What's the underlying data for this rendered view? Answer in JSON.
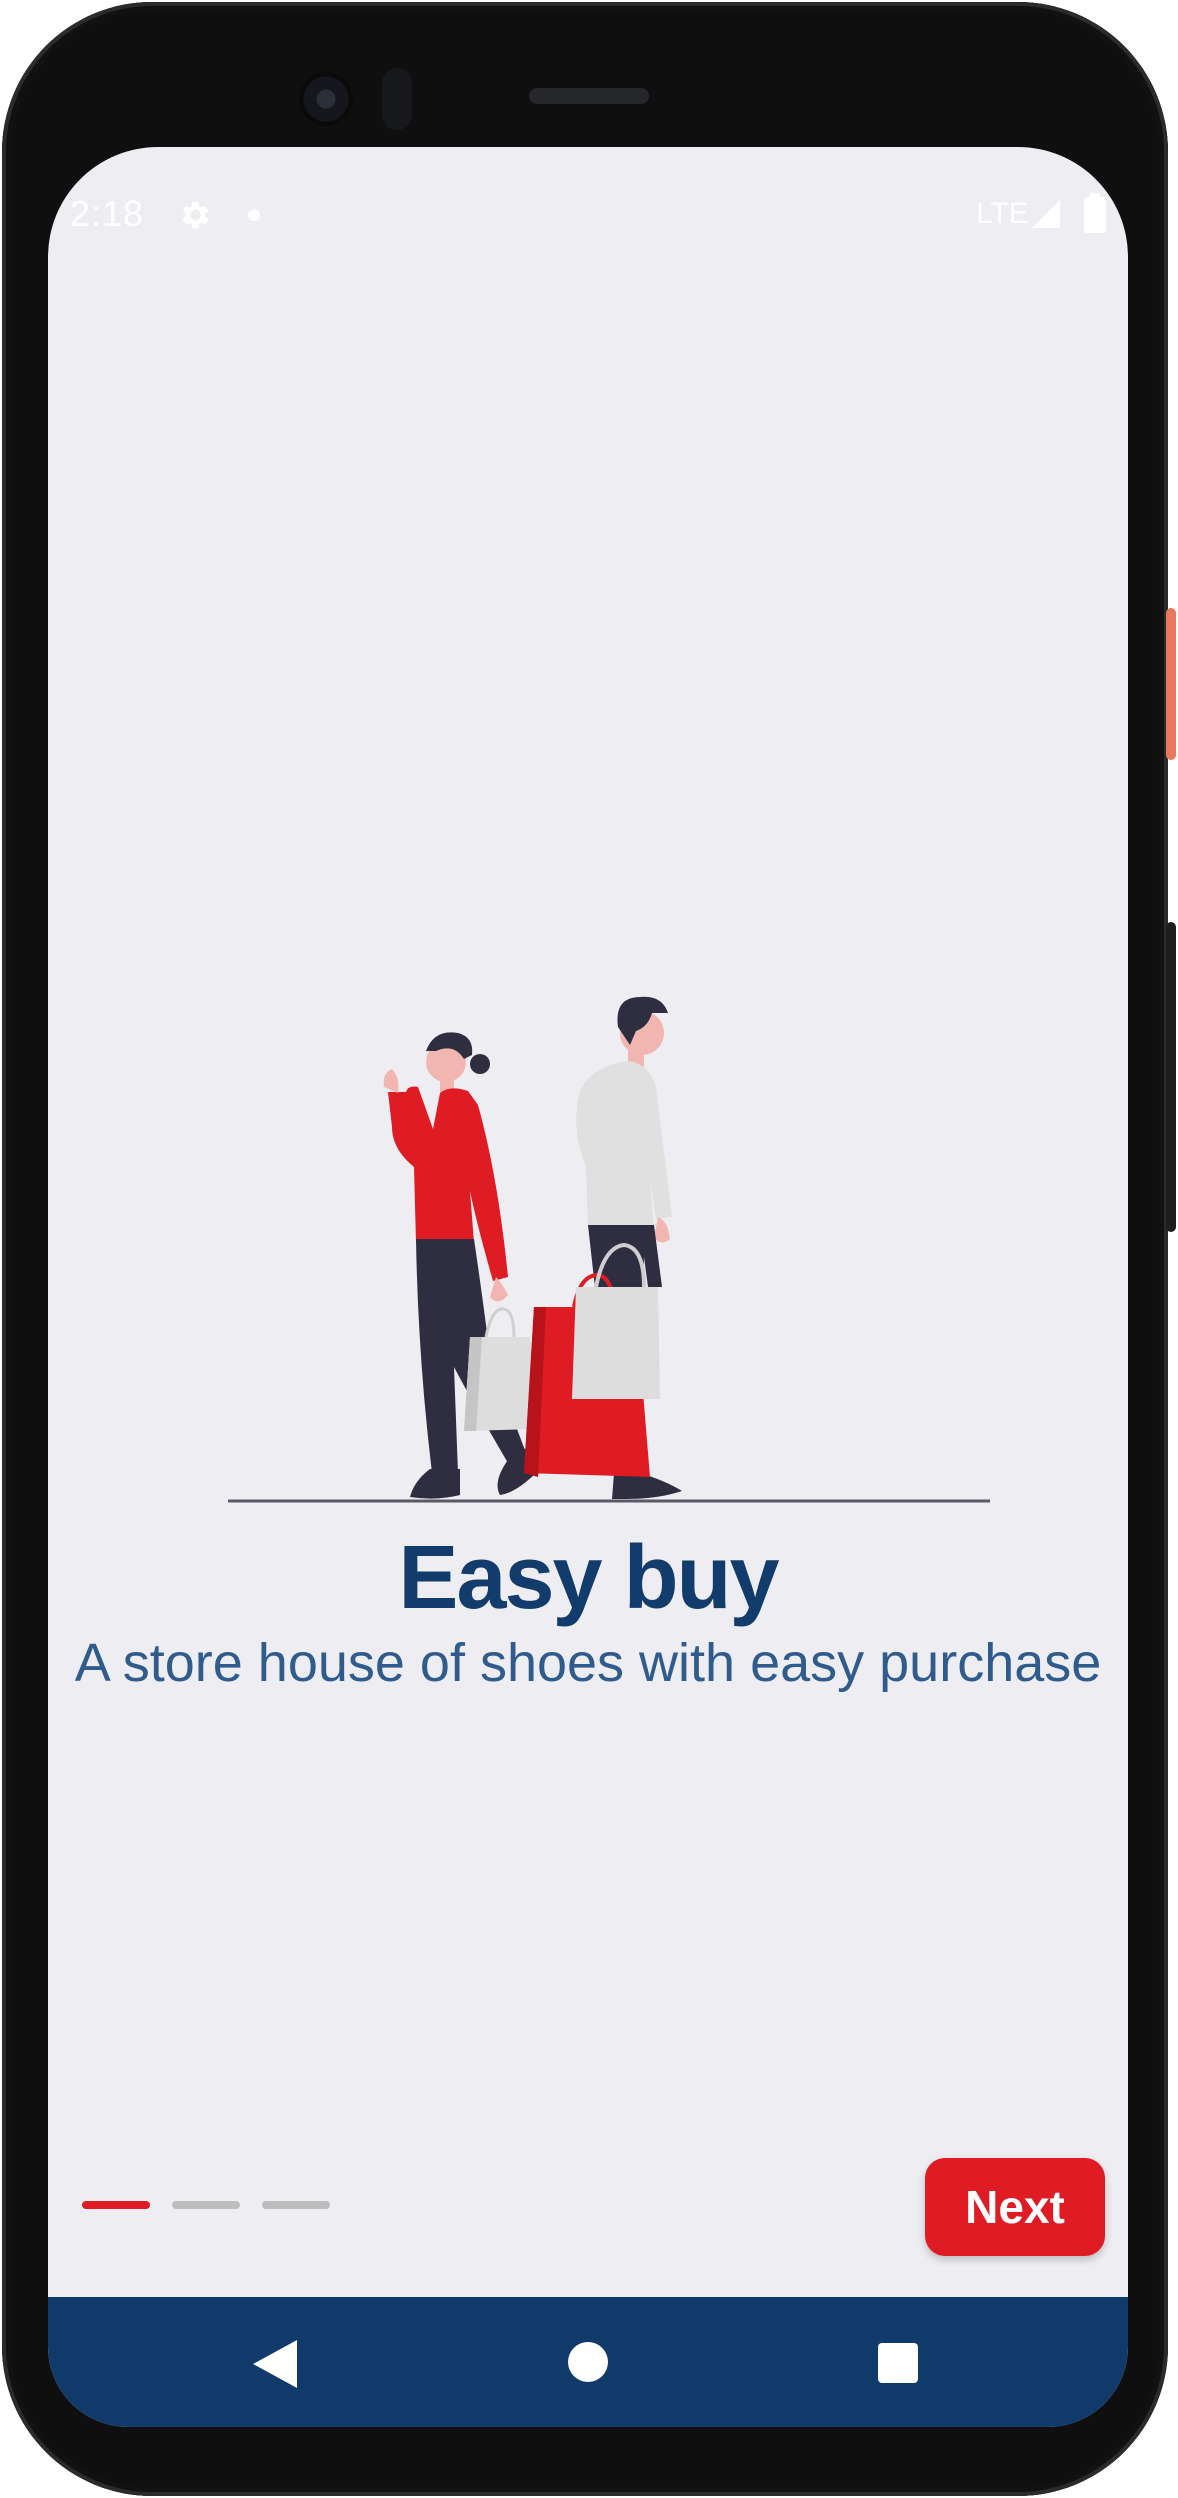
{
  "status_bar": {
    "time": "2:18",
    "network": "LTE",
    "icons": [
      "gear-icon",
      "notification-dot-icon",
      "signal-icon",
      "battery-icon"
    ]
  },
  "onboarding": {
    "title": "Easy buy",
    "subtitle": "A store house of shoes with easy purchase",
    "illustration": "shopping-people-illustration",
    "page_indicator": {
      "total": 3,
      "active_index": 0,
      "active_color": "#df1b24",
      "inactive_color": "#bdbdbd"
    },
    "next_label": "Next"
  },
  "navigation_bar": {
    "icons": [
      "back-icon",
      "home-icon",
      "recents-icon"
    ]
  },
  "colors": {
    "brand_blue": "#123c6b",
    "accent_red": "#df1b24",
    "background": "#eeedf1",
    "nav_bar": "#0f3a6a"
  }
}
